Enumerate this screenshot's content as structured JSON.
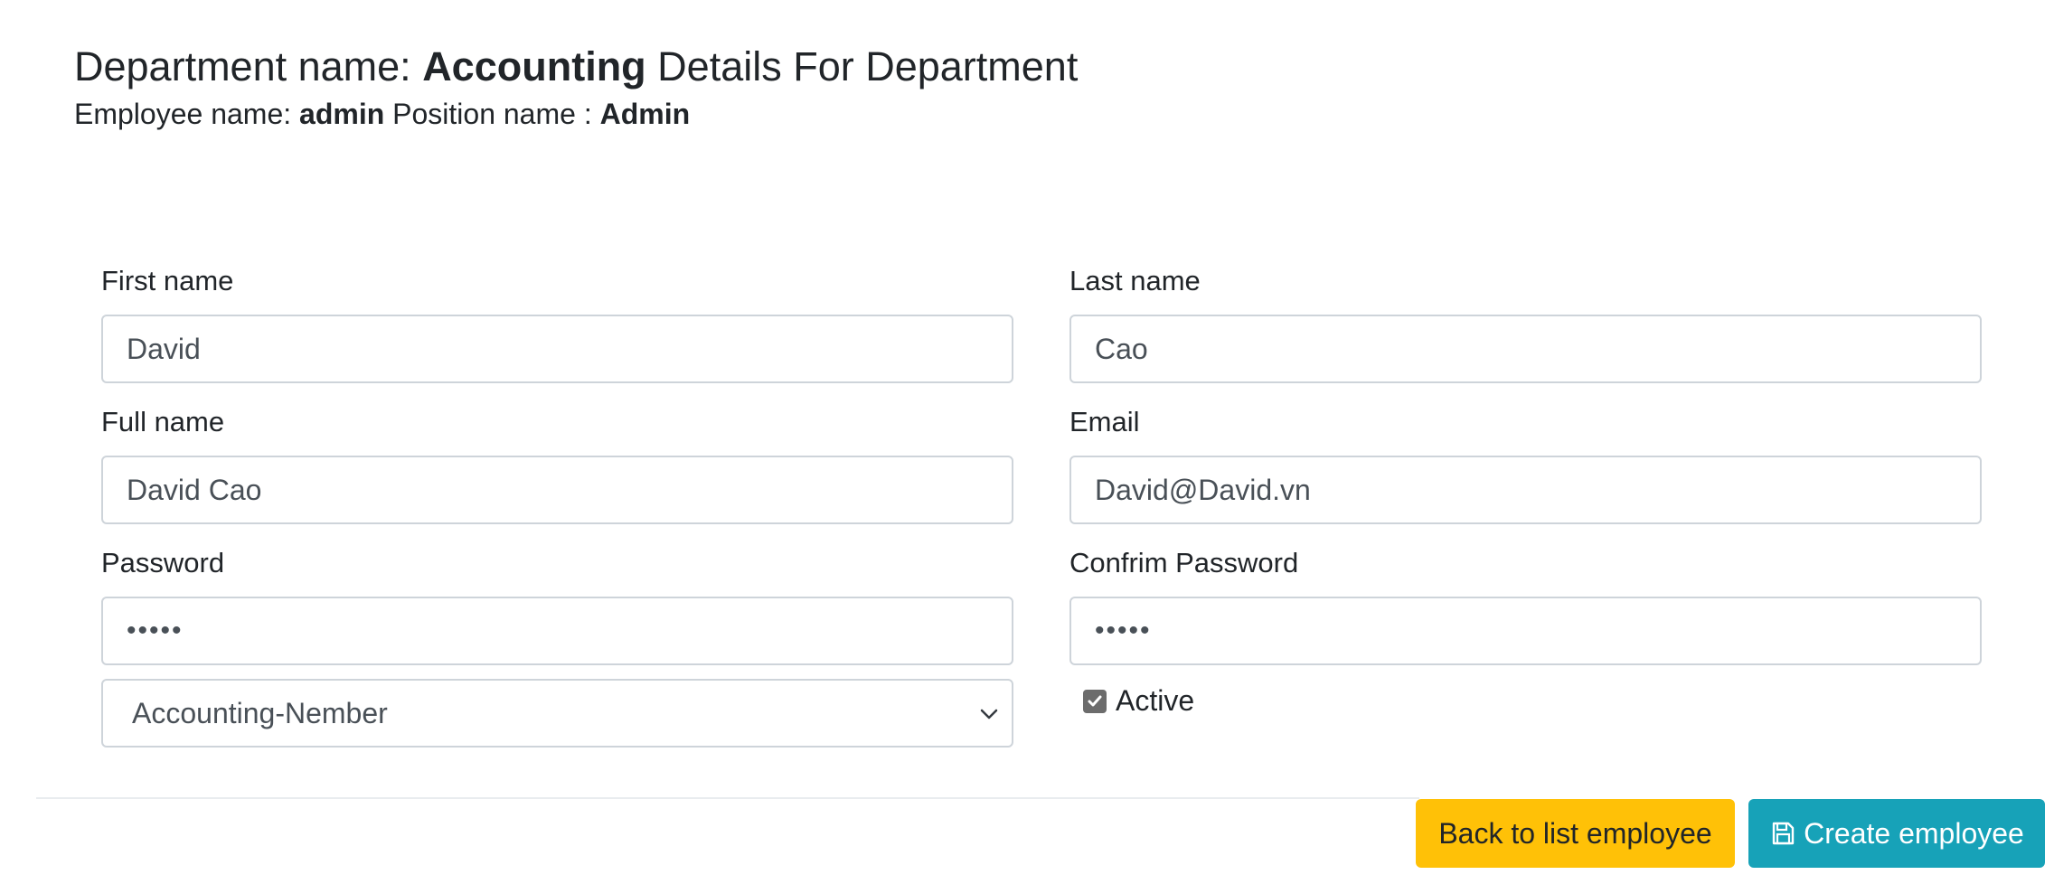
{
  "header": {
    "department_prefix": "Department name: ",
    "department_name": "Accounting",
    "department_suffix": " Details For Department",
    "employee_prefix": "Employee name: ",
    "employee_name": "admin",
    "position_prefix": " Position name : ",
    "position_name": "Admin"
  },
  "form": {
    "first_name": {
      "label": "First name",
      "value": "David"
    },
    "last_name": {
      "label": "Last name",
      "value": "Cao"
    },
    "full_name": {
      "label": "Full name",
      "value": "David Cao"
    },
    "email": {
      "label": "Email",
      "value": "David@David.vn"
    },
    "password": {
      "label": "Password",
      "value": "•••••"
    },
    "confirm_password": {
      "label": "Confrim Password",
      "value": "•••••"
    },
    "position_select": {
      "selected": "Accounting-Nember"
    },
    "active": {
      "label": "Active",
      "checked": true
    }
  },
  "actions": {
    "back_label": "Back to list employee",
    "create_label": "Create employee"
  },
  "colors": {
    "back_button": "#ffc107",
    "create_button": "#17a2b8"
  }
}
